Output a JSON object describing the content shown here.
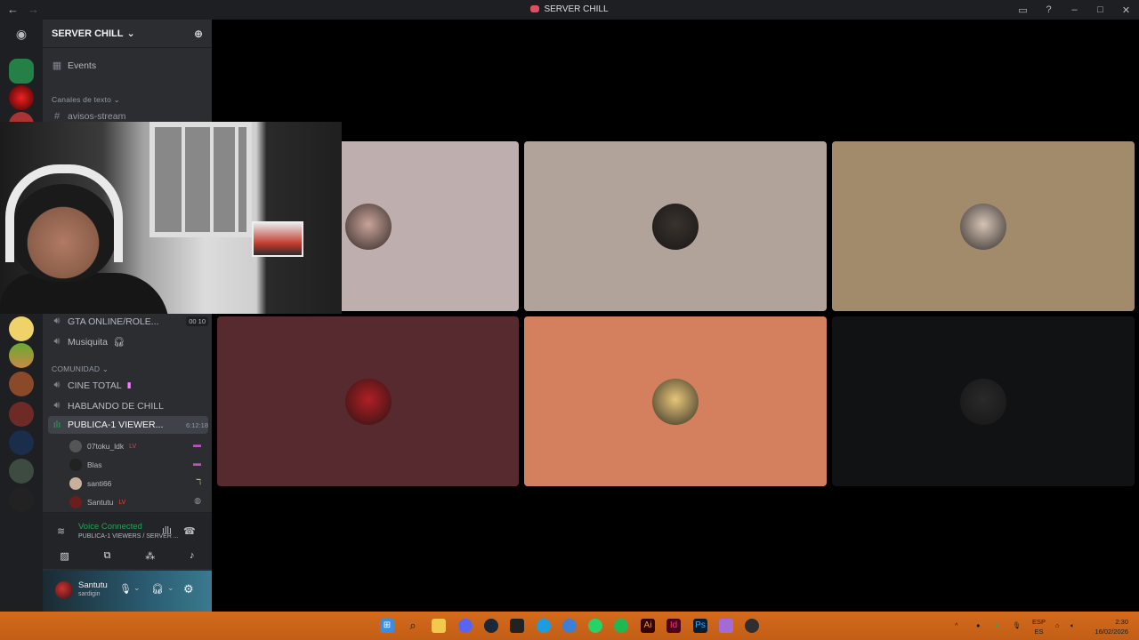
{
  "window": {
    "title": "SERVER CHILL"
  },
  "server": {
    "name": "SERVER CHILL"
  },
  "channels": {
    "events": "Events",
    "category_text": "Canales de texto",
    "avisos": "avisos-stream",
    "gta": "GTA ONLINE/ROLE...",
    "gta_count": "00  10",
    "musiquita": "Musiquita",
    "category_comunidad": "COMUNIDAD",
    "cine": "CINE TOTAL",
    "hablando": "HABLANDO DE CHILL",
    "publica": "PUBLICA-1 VIEWER...",
    "publica_timer": "6:12:18"
  },
  "members": [
    {
      "name": "07toku_ldk",
      "live": "LV"
    },
    {
      "name": "Blas",
      "live": ""
    },
    {
      "name": "santi66",
      "live": ""
    },
    {
      "name": "Santutu",
      "live": "LV"
    }
  ],
  "voice": {
    "status": "Voice Connected",
    "location": "PUBLICA-1 VIEWERS  /  SERVER ..."
  },
  "user": {
    "name": "Santutu",
    "status": "sardigin"
  },
  "stage_tiles": [
    {
      "bg": "#bfaeae",
      "avatar": "#caa398"
    },
    {
      "bg": "#b2a39a",
      "avatar": "#3a332e"
    },
    {
      "bg": "#a18b6b",
      "avatar": "#d6c3b4"
    },
    {
      "bg": "#572a2f",
      "avatar": "#b01f25"
    },
    {
      "bg": "#d4805f",
      "avatar": "#e7c67a"
    },
    {
      "bg": "#111214",
      "avatar": "#2a2a2a"
    }
  ],
  "taskbar": {
    "lang": "ESP",
    "lang_sub": "ES",
    "time": "2:30",
    "date": "16/02/2026"
  }
}
